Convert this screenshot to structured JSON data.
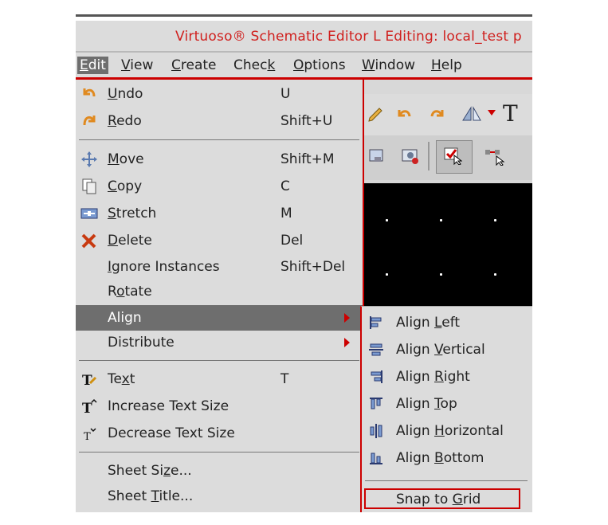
{
  "window": {
    "title": "Virtuoso® Schematic Editor L Editing: local_test p"
  },
  "menubar": [
    {
      "pre": "",
      "u": "E",
      "post": "dit"
    },
    {
      "pre": "",
      "u": "V",
      "post": "iew"
    },
    {
      "pre": "",
      "u": "C",
      "post": "reate"
    },
    {
      "pre": "Chec",
      "u": "k",
      "post": ""
    },
    {
      "pre": "",
      "u": "O",
      "post": "ptions"
    },
    {
      "pre": "",
      "u": "W",
      "post": "indow"
    },
    {
      "pre": "",
      "u": "H",
      "post": "elp"
    }
  ],
  "edit_menu": {
    "items": [
      {
        "pre": "",
        "u": "U",
        "post": "ndo",
        "shortcut": "U",
        "icon": "undo-icon"
      },
      {
        "pre": "",
        "u": "R",
        "post": "edo",
        "shortcut": "Shift+U",
        "icon": "redo-icon"
      },
      {
        "pre": "",
        "u": "M",
        "post": "ove",
        "shortcut": "Shift+M",
        "icon": "move-icon"
      },
      {
        "pre": "",
        "u": "C",
        "post": "opy",
        "shortcut": "C",
        "icon": "copy-icon"
      },
      {
        "pre": "",
        "u": "S",
        "post": "tretch",
        "shortcut": "M",
        "icon": "stretch-icon"
      },
      {
        "pre": "",
        "u": "D",
        "post": "elete",
        "shortcut": "Del",
        "icon": "delete-icon"
      },
      {
        "pre": "",
        "u": "I",
        "post": "gnore Instances",
        "shortcut": "Shift+Del",
        "icon": ""
      },
      {
        "pre": "R",
        "u": "o",
        "post": "tate",
        "shortcut": "",
        "icon": ""
      },
      {
        "pre": "Align",
        "u": "",
        "post": "",
        "shortcut": "",
        "icon": ""
      },
      {
        "pre": "Distribute",
        "u": "",
        "post": "",
        "shortcut": "",
        "icon": ""
      },
      {
        "pre": "Te",
        "u": "x",
        "post": "t",
        "shortcut": "T",
        "icon": "text-icon"
      },
      {
        "pre": "Increase Text Size",
        "u": "",
        "post": "",
        "shortcut": "",
        "icon": "increase-text-size-icon"
      },
      {
        "pre": "Decrease Text Size",
        "u": "",
        "post": "",
        "shortcut": "",
        "icon": "decrease-text-size-icon"
      },
      {
        "pre": "Sheet Si",
        "u": "z",
        "post": "e...",
        "shortcut": "",
        "icon": ""
      },
      {
        "pre": "Sheet ",
        "u": "T",
        "post": "itle...",
        "shortcut": "",
        "icon": ""
      }
    ]
  },
  "align_submenu": {
    "items": [
      {
        "pre": "Align ",
        "u": "L",
        "post": "eft",
        "icon": "align-left-icon"
      },
      {
        "pre": "Align ",
        "u": "V",
        "post": "ertical",
        "icon": "align-vertical-icon"
      },
      {
        "pre": "Align ",
        "u": "R",
        "post": "ight",
        "icon": "align-right-icon"
      },
      {
        "pre": "Align ",
        "u": "T",
        "post": "op",
        "icon": "align-top-icon"
      },
      {
        "pre": "Align ",
        "u": "H",
        "post": "orizontal",
        "icon": "align-horizontal-icon"
      },
      {
        "pre": "Align ",
        "u": "B",
        "post": "ottom",
        "icon": "align-bottom-icon"
      }
    ],
    "snap": {
      "pre": "Snap to ",
      "u": "G",
      "post": "rid"
    }
  },
  "toolbar_partial_text": "T",
  "colors": {
    "accent_red": "#cc0000",
    "menu_bg": "#dcdcdc",
    "selected_bg": "#6e6e6e",
    "canvas_bg": "#000000"
  }
}
